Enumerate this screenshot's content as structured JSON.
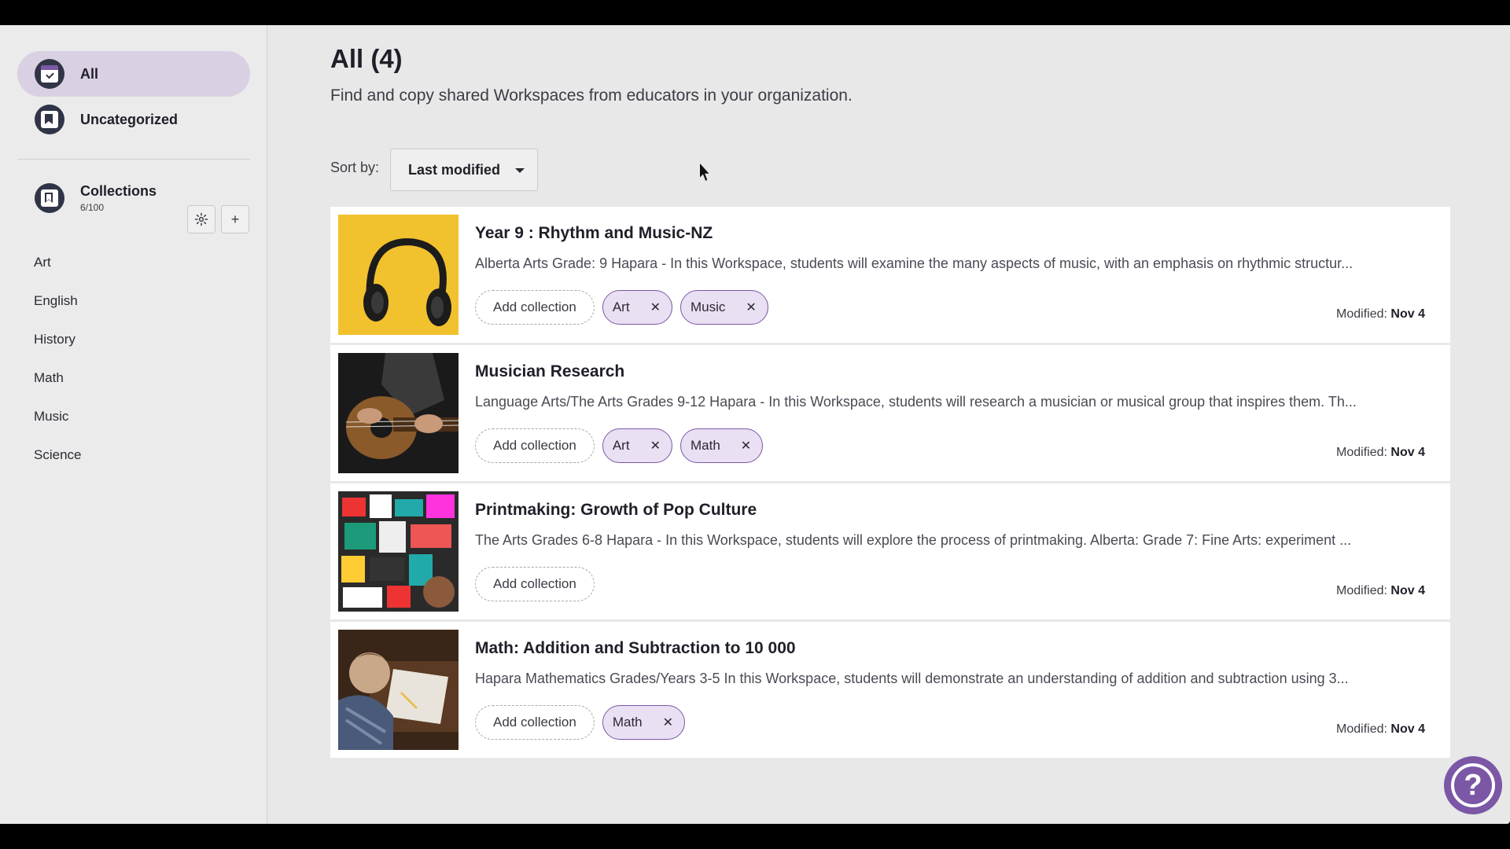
{
  "sidebar": {
    "nav": [
      {
        "label": "All",
        "active": true,
        "icon": "all-check-icon"
      },
      {
        "label": "Uncategorized",
        "active": false,
        "icon": "bookmark-icon"
      }
    ],
    "collections": {
      "title": "Collections",
      "count": "6/100",
      "settings_icon": "gear-icon",
      "add_icon": "plus-icon",
      "add_symbol": "+",
      "items": [
        "Art",
        "English",
        "History",
        "Math",
        "Music",
        "Science"
      ]
    }
  },
  "main": {
    "title_bold": "All",
    "title_count": "(4)",
    "subtitle": "Find and copy shared Workspaces from educators in your organization.",
    "sort_label": "Sort by:",
    "sort_value": "Last modified",
    "add_collection_label": "Add collection",
    "modified_label": "Modified:",
    "cards": [
      {
        "title": "Year 9 : Rhythm and Music-NZ",
        "description": "Alberta Arts Grade: 9 Hapara - In this Workspace, students will examine the many aspects of music, with an emphasis on rhythmic structur...",
        "tags": [
          "Art",
          "Music"
        ],
        "modified": "Nov 4",
        "thumb": "headphones-image"
      },
      {
        "title": "Musician Research",
        "description": "Language Arts/The Arts Grades 9-12 Hapara - In this Workspace, students will research a musician or musical group that inspires them. Th...",
        "tags": [
          "Art",
          "Math"
        ],
        "modified": "Nov 4",
        "thumb": "guitar-image"
      },
      {
        "title": "Printmaking: Growth of Pop Culture",
        "description": "The Arts Grades 6-8 Hapara - In this Workspace, students will explore the process of printmaking. Alberta: Grade 7: Fine Arts: experiment ...",
        "tags": [],
        "modified": "Nov 4",
        "thumb": "stickers-image"
      },
      {
        "title": "Math: Addition and Subtraction to 10 000",
        "description": "Hapara Mathematics Grades/Years 3-5 In this Workspace, students will demonstrate an understanding of addition and subtraction using 3...",
        "tags": [
          "Math"
        ],
        "modified": "Nov 4",
        "thumb": "child-writing-image"
      }
    ],
    "tag_remove_symbol": "✕"
  },
  "help": {
    "icon": "help-question-icon",
    "symbol": "?"
  },
  "colors": {
    "accent": "#7b57a6",
    "tag_bg": "#eae0f3",
    "active_nav": "#d9d1e3"
  }
}
